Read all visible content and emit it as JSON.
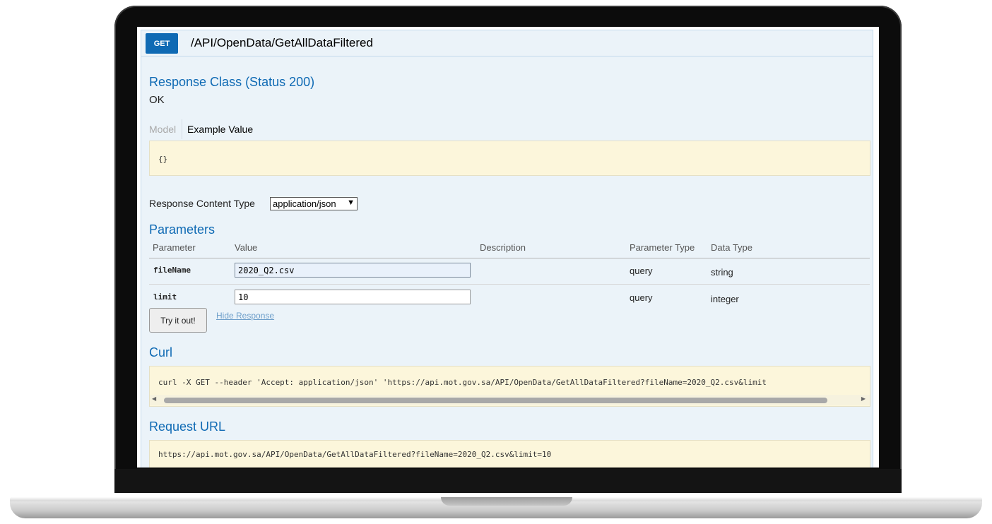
{
  "operation": {
    "method": "GET",
    "path": "/API/OpenData/GetAllDataFiltered"
  },
  "response_class": {
    "title": "Response Class (Status 200)",
    "status_text": "OK",
    "tabs": [
      "Model",
      "Example Value"
    ],
    "example_value": "{}"
  },
  "content_type": {
    "label": "Response Content Type",
    "selected": "application/json"
  },
  "parameters": {
    "title": "Parameters",
    "headers": [
      "Parameter",
      "Value",
      "Description",
      "Parameter Type",
      "Data Type"
    ],
    "rows": [
      {
        "name": "fileName",
        "value": "2020_Q2.csv",
        "description": "",
        "param_type": "query",
        "data_type": "string"
      },
      {
        "name": "limit",
        "value": "10",
        "description": "",
        "param_type": "query",
        "data_type": "integer"
      }
    ]
  },
  "actions": {
    "try_label": "Try it out!",
    "hide_label": "Hide Response"
  },
  "curl": {
    "title": "Curl",
    "command": "curl -X GET --header 'Accept: application/json' 'https://api.mot.gov.sa/API/OpenData/GetAllDataFiltered?fileName=2020_Q2.csv&limit"
  },
  "request_url": {
    "title": "Request URL",
    "url": "https://api.mot.gov.sa/API/OpenData/GetAllDataFiltered?fileName=2020_Q2.csv&limit=10"
  },
  "colors": {
    "accent": "#0f6ab4",
    "panel_bg": "#ebf3f9",
    "code_bg": "#fcf6db"
  }
}
